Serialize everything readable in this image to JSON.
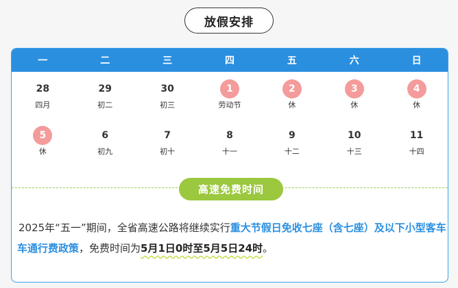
{
  "section_title": "放假安排",
  "weekdays": [
    "一",
    "二",
    "三",
    "四",
    "五",
    "六",
    "日"
  ],
  "calendar_rows": [
    [
      {
        "day": "28",
        "note": "四月",
        "holiday": false
      },
      {
        "day": "29",
        "note": "初二",
        "holiday": false
      },
      {
        "day": "30",
        "note": "初三",
        "holiday": false
      },
      {
        "day": "1",
        "note": "劳动节",
        "holiday": true
      },
      {
        "day": "2",
        "note": "休",
        "holiday": true
      },
      {
        "day": "3",
        "note": "休",
        "holiday": true
      },
      {
        "day": "4",
        "note": "休",
        "holiday": true
      }
    ],
    [
      {
        "day": "5",
        "note": "休",
        "holiday": true
      },
      {
        "day": "6",
        "note": "初九",
        "holiday": false
      },
      {
        "day": "7",
        "note": "初十",
        "holiday": false
      },
      {
        "day": "8",
        "note": "十一",
        "holiday": false
      },
      {
        "day": "9",
        "note": "十二",
        "holiday": false
      },
      {
        "day": "10",
        "note": "十三",
        "holiday": false
      },
      {
        "day": "11",
        "note": "十四",
        "holiday": false
      }
    ]
  ],
  "free_time_label": "高速免费时间",
  "notice": {
    "part1": "2025年“五一”期间，全省高速公路将继续实行",
    "highlight": "重大节假日免收七座（含七座）及以下小型客车车通行费政策",
    "part2": "，免费时间为",
    "bold": "5月1日0时至5月5日24时",
    "end": "。"
  },
  "colors": {
    "header_blue": "#2b8fe0",
    "holiday_pink": "#f49b9b",
    "green_pill": "#9bc83e"
  }
}
